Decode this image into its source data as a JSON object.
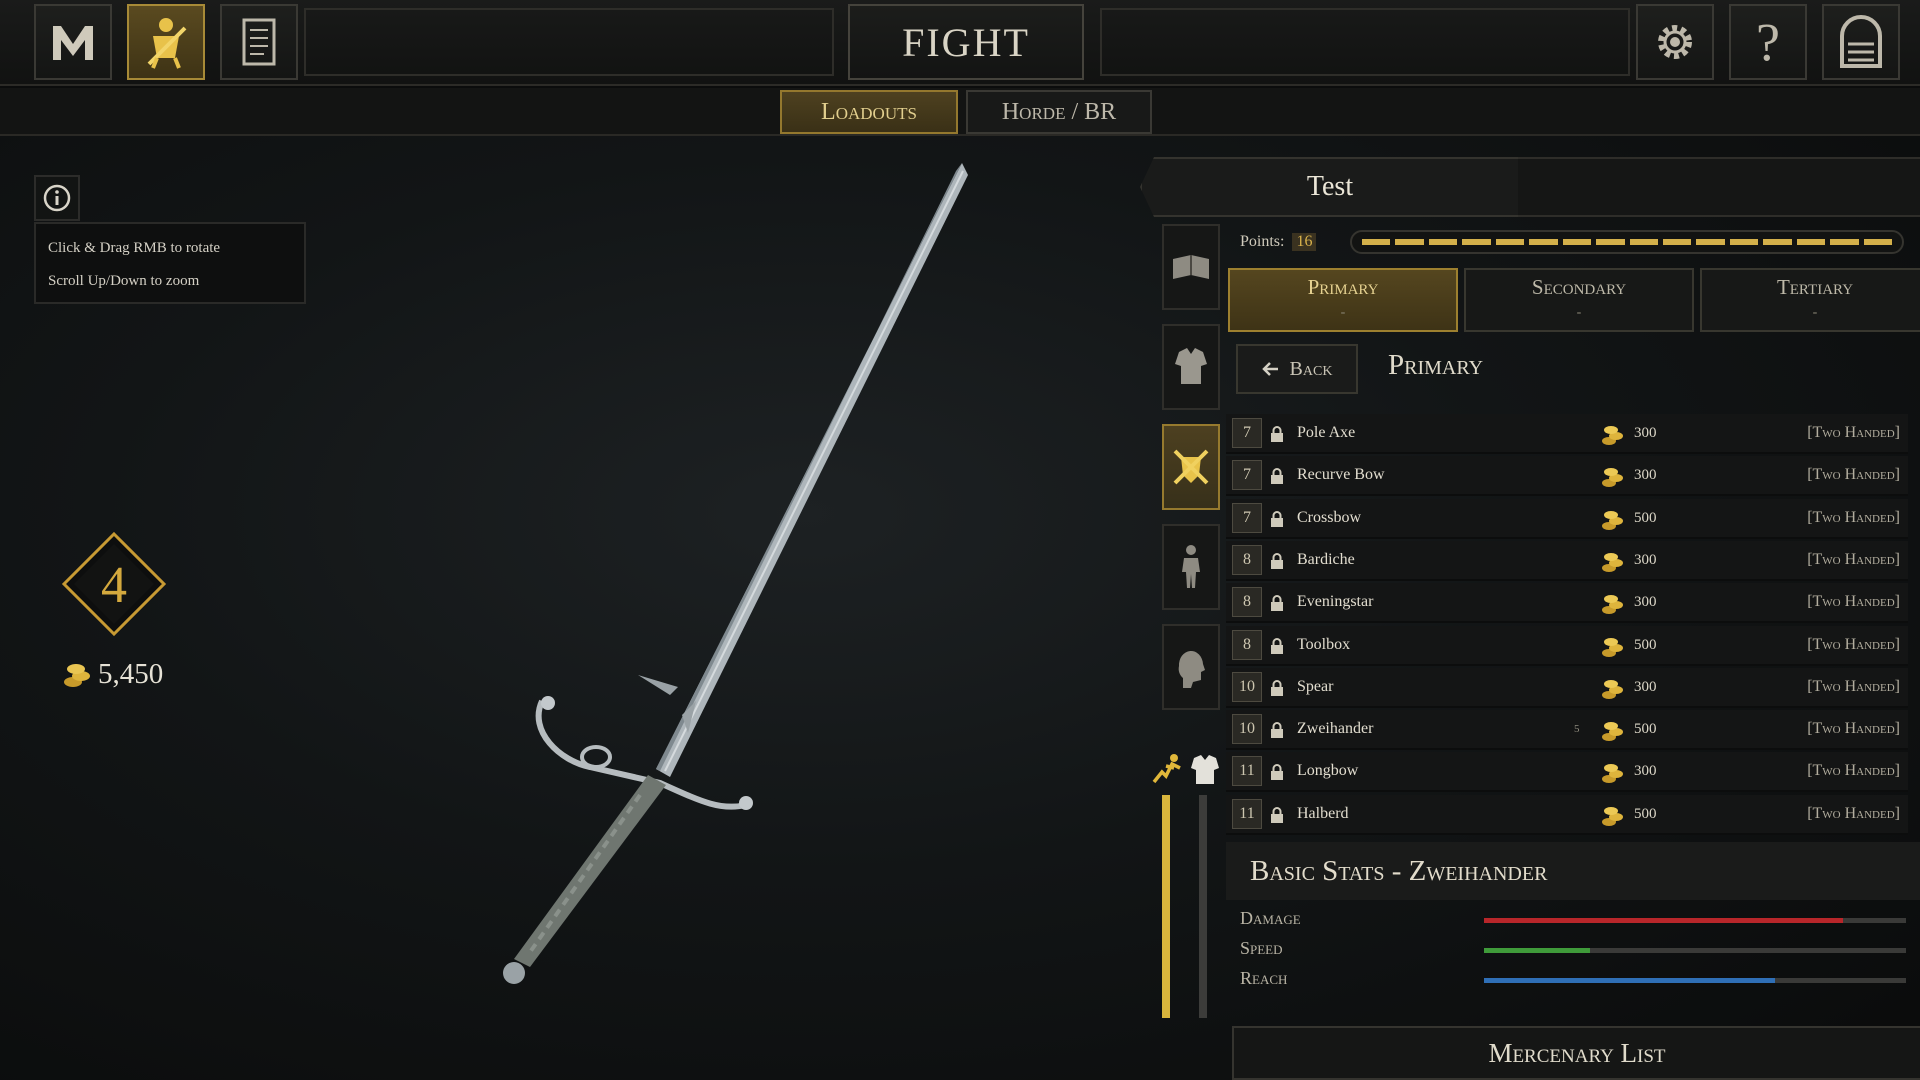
{
  "header": {
    "title": "FIGHT",
    "subtabs": [
      {
        "label": "Loadouts",
        "active": true
      },
      {
        "label": "Horde / BR",
        "active": false
      }
    ]
  },
  "help": {
    "line1": "Click & Drag RMB to rotate",
    "line2": "Scroll Up/Down to zoom"
  },
  "player": {
    "level": "4",
    "gold": "5,450"
  },
  "loadout": {
    "name": "Test",
    "points_label": "Points:",
    "points_value": "16",
    "points_segments": 16
  },
  "weapon_tabs": [
    {
      "label": "Primary",
      "value": "-",
      "active": true
    },
    {
      "label": "Secondary",
      "value": "-",
      "active": false
    },
    {
      "label": "Tertiary",
      "value": "-",
      "active": false
    }
  ],
  "back_label": "Back",
  "section_title": "Primary",
  "weapons": [
    {
      "level": "7",
      "name": "Pole Axe",
      "price": "300",
      "class": "[Two Handed]"
    },
    {
      "level": "7",
      "name": "Recurve Bow",
      "price": "300",
      "class": "[Two Handed]"
    },
    {
      "level": "7",
      "name": "Crossbow",
      "price": "500",
      "class": "[Two Handed]"
    },
    {
      "level": "8",
      "name": "Bardiche",
      "price": "300",
      "class": "[Two Handed]"
    },
    {
      "level": "8",
      "name": "Eveningstar",
      "price": "300",
      "class": "[Two Handed]"
    },
    {
      "level": "8",
      "name": "Toolbox",
      "price": "500",
      "class": "[Two Handed]"
    },
    {
      "level": "10",
      "name": "Spear",
      "price": "300",
      "class": "[Two Handed]"
    },
    {
      "level": "10",
      "name": "Zweihander",
      "price": "500",
      "class": "[Two Handed]",
      "badge": "5"
    },
    {
      "level": "11",
      "name": "Longbow",
      "price": "300",
      "class": "[Two Handed]"
    },
    {
      "level": "11",
      "name": "Halberd",
      "price": "500",
      "class": "[Two Handed]"
    }
  ],
  "stats": {
    "title": "Basic Stats - Zweihander",
    "items": [
      {
        "label": "Damage",
        "value": 0.85,
        "color": "#b8262a"
      },
      {
        "label": "Speed",
        "value": 0.25,
        "color": "#3f9b3a"
      },
      {
        "label": "Reach",
        "value": 0.69,
        "color": "#2f6fb6"
      }
    ]
  },
  "mercenary_label": "Mercenary List",
  "colors": {
    "gold": "#d4a93e",
    "active_tab": "#55461f"
  },
  "icons": {
    "menu": "m-logo-icon",
    "fight": "knight-icon",
    "scroll": "scroll-icon",
    "settings": "gear-icon",
    "help": "question-icon",
    "exit": "gate-icon"
  }
}
